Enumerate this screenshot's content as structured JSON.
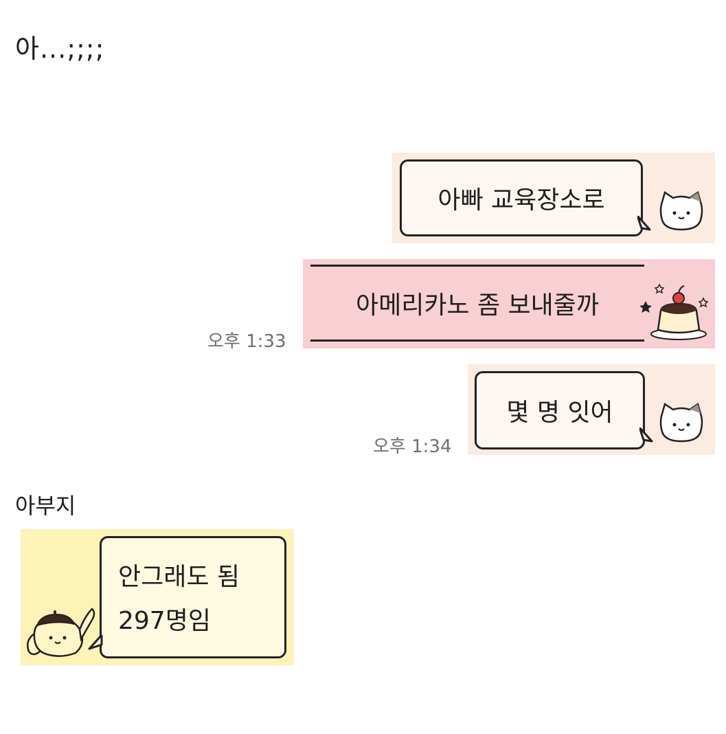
{
  "caption": "아...;;;;",
  "messages": [
    {
      "text": "아빠 교육장소로",
      "sticker": "white-cat-sticker-icon"
    },
    {
      "text": "아메리카노 좀 보내줄까",
      "time": "오후 1:33",
      "sticker": "pudding-sticker-icon"
    },
    {
      "text": "몇 명 잇어",
      "time": "오후 1:34",
      "sticker": "white-cat-sticker-icon"
    }
  ],
  "reply": {
    "sender": "아부지",
    "lines": [
      "안그래도 됨",
      "297명임"
    ],
    "sticker": "pompompurin-sticker-icon"
  },
  "colors": {
    "sent_bg": "#fcebe1",
    "pink_bg": "#f8cfd3",
    "reply_bg": "#fdf3b7",
    "timestamp": "#6f6f6f"
  }
}
